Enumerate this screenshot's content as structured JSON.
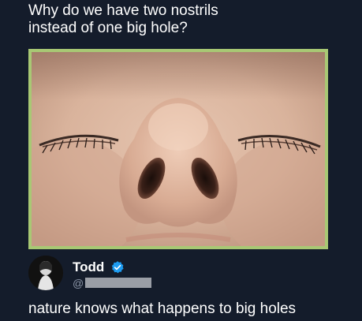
{
  "post": {
    "question": "Why do we have two nostrils\ninstead of one big hole?"
  },
  "reply": {
    "display_name": "Todd",
    "handle_prefix": "@",
    "verified_icon": "verified-badge-icon",
    "text": "nature knows what happens to big holes"
  },
  "colors": {
    "background": "#141c2b",
    "photo_border": "#a8c874",
    "verified_badge": "#1d9bf0",
    "text": "#ffffff",
    "handle_redaction": "#9a9ea6"
  }
}
